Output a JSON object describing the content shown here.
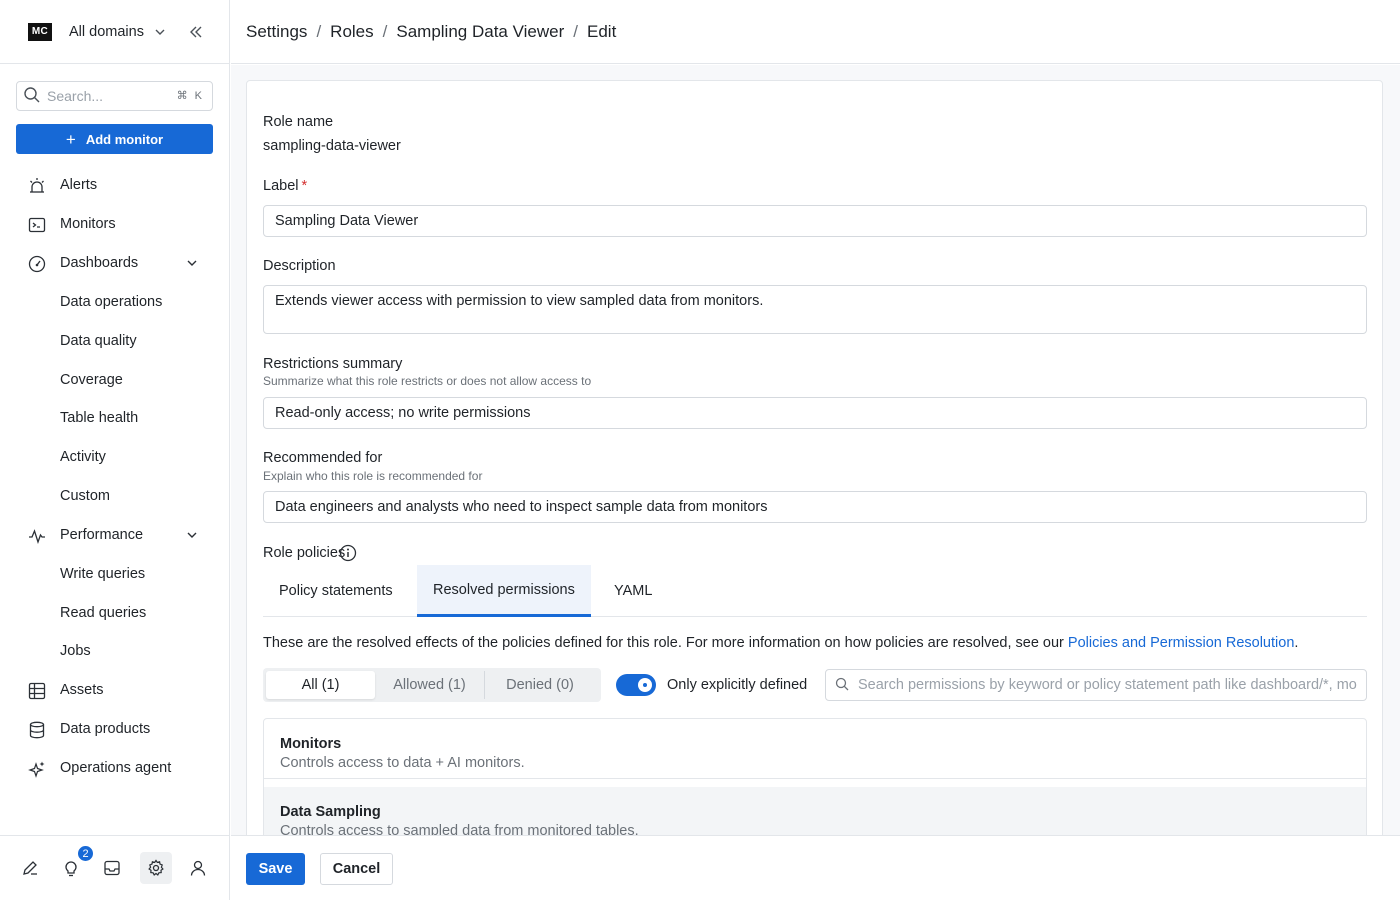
{
  "sidebar": {
    "logo": "MC",
    "domain": "All domains",
    "search_placeholder": "Search...",
    "search_shortcut": "⌘ K",
    "add_button": "Add monitor",
    "nav": [
      {
        "label": "Alerts",
        "icon": "alert-siren-icon"
      },
      {
        "label": "Monitors",
        "icon": "terminal-icon"
      },
      {
        "label": "Dashboards",
        "icon": "gauge-icon",
        "expanded": true
      },
      {
        "label": "Data operations"
      },
      {
        "label": "Data quality"
      },
      {
        "label": "Coverage"
      },
      {
        "label": "Table health"
      },
      {
        "label": "Activity"
      },
      {
        "label": "Custom"
      },
      {
        "label": "Performance",
        "icon": "pulse-icon",
        "expanded": true
      },
      {
        "label": "Write queries"
      },
      {
        "label": "Read queries"
      },
      {
        "label": "Jobs"
      },
      {
        "label": "Assets",
        "icon": "table-grid-icon"
      },
      {
        "label": "Data products",
        "icon": "database-icon"
      },
      {
        "label": "Operations agent",
        "icon": "sparkle-icon"
      }
    ],
    "bottom": {
      "notifications_count": "2"
    }
  },
  "header": {
    "breadcrumbs": [
      "Settings",
      "Roles",
      "Sampling Data Viewer",
      "Edit"
    ]
  },
  "form": {
    "role_name_label": "Role name",
    "role_name_value": "sampling-data-viewer",
    "label_label": "Label",
    "label_required": "*",
    "label_value": "Sampling Data Viewer",
    "description_label": "Description",
    "description_value": "Extends viewer access with permission to view sampled data from monitors.",
    "restrictions_label": "Restrictions summary",
    "restrictions_help": "Summarize what this role restricts or does not allow access to",
    "restrictions_value": "Read-only access; no write permissions",
    "recommended_label": "Recommended for",
    "recommended_help": "Explain who this role is recommended for",
    "recommended_value": "Data engineers and analysts who need to inspect sample data from monitors",
    "policies_label": "Role policies"
  },
  "tabs": {
    "items": [
      "Policy statements",
      "Resolved permissions",
      "YAML"
    ],
    "active": "Resolved permissions"
  },
  "resolved": {
    "text": "These are the resolved effects of the policies defined for this role. For more information on how policies are resolved, see our ",
    "link": "Policies and Permission Resolution",
    "period": "."
  },
  "filters": {
    "segments": [
      "All (1)",
      "Allowed (1)",
      "Denied (0)"
    ],
    "active_segment": "All (1)",
    "toggle_label": "Only explicitly defined",
    "toggle_on": true,
    "search_placeholder": "Search permissions by keyword or policy statement path like dashboard/*, mo"
  },
  "permissions": [
    {
      "title": "Monitors",
      "description": "Controls access to data + AI monitors."
    },
    {
      "title": "Data Sampling",
      "description": "Controls access to sampled data from monitored tables."
    }
  ],
  "footer": {
    "save": "Save",
    "cancel": "Cancel"
  },
  "colors": {
    "accent": "#1769d6",
    "required": "#d32f2f",
    "border": "#e3e6ea"
  }
}
